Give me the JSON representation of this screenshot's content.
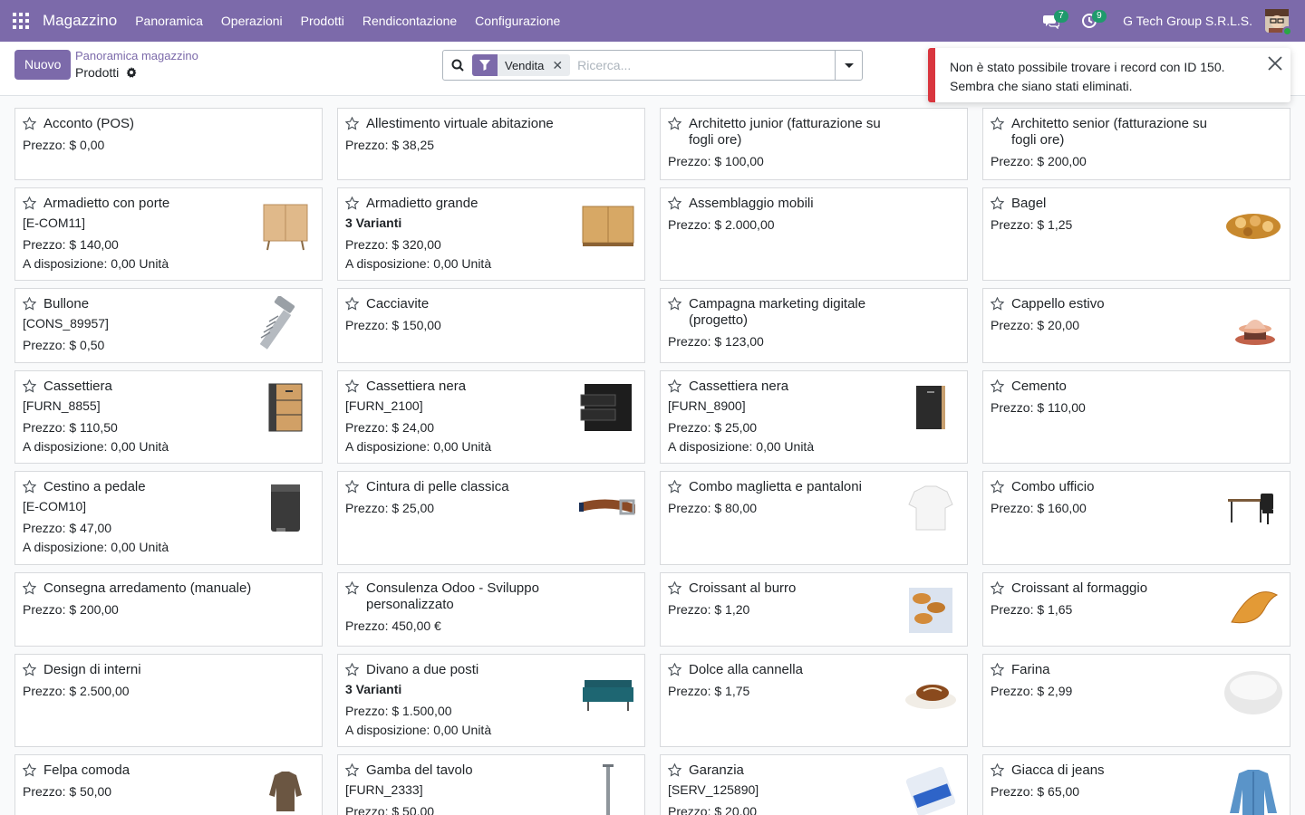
{
  "nav": {
    "app_name": "Magazzino",
    "menu": [
      "Panoramica",
      "Operazioni",
      "Prodotti",
      "Rendicontazione",
      "Configurazione"
    ],
    "messages_count": "7",
    "activities_count": "9",
    "company": "G Tech Group S.R.L.S."
  },
  "control": {
    "new_label": "Nuovo",
    "breadcrumb": "Panoramica magazzino",
    "title": "Prodotti",
    "facet_label": "Vendita",
    "search_placeholder": "Ricerca..."
  },
  "notification": {
    "text": "Non è stato possibile trovare i record con ID 150. Sembra che siano stati eliminati."
  },
  "products": [
    {
      "name": "Acconto (POS)",
      "sub": "",
      "price": "Prezzo: $ 0,00",
      "avail": "",
      "icon": "none"
    },
    {
      "name": "Allestimento virtuale abitazione",
      "sub": "",
      "price": "Prezzo: $ 38,25",
      "avail": "",
      "icon": "none"
    },
    {
      "name": "Architetto junior (fatturazione su fogli ore)",
      "sub": "",
      "price": "Prezzo: $ 100,00",
      "avail": "",
      "icon": "none"
    },
    {
      "name": "Architetto senior (fatturazione su fogli ore)",
      "sub": "",
      "price": "Prezzo: $ 200,00",
      "avail": "",
      "icon": "none"
    },
    {
      "name": "Armadietto con porte",
      "sub": "[E-COM11]",
      "price": "Prezzo: $ 140,00",
      "avail": "A disposizione: 0,00 Unità",
      "icon": "cabinet-doors"
    },
    {
      "name": "Armadietto grande",
      "sub": "3 Varianti",
      "subBold": true,
      "price": "Prezzo: $ 320,00",
      "avail": "A disposizione: 0,00 Unità",
      "icon": "cabinet-large"
    },
    {
      "name": "Assemblaggio mobili",
      "sub": "",
      "price": "Prezzo: $ 2.000,00",
      "avail": "",
      "icon": "none"
    },
    {
      "name": "Bagel",
      "sub": "",
      "price": "Prezzo: $ 1,25",
      "avail": "",
      "icon": "bagels"
    },
    {
      "name": "Bullone",
      "sub": "[CONS_89957]",
      "price": "Prezzo: $ 0,50",
      "avail": "",
      "icon": "bolt"
    },
    {
      "name": "Cacciavite",
      "sub": "",
      "price": "Prezzo: $ 150,00",
      "avail": "",
      "icon": "none"
    },
    {
      "name": "Campagna marketing digitale (progetto)",
      "sub": "",
      "price": "Prezzo: $ 123,00",
      "avail": "",
      "icon": "none"
    },
    {
      "name": "Cappello estivo",
      "sub": "",
      "price": "Prezzo: $ 20,00",
      "avail": "",
      "icon": "hats"
    },
    {
      "name": "Cassettiera",
      "sub": "[FURN_8855]",
      "price": "Prezzo: $ 110,50",
      "avail": "A disposizione: 0,00 Unità",
      "icon": "drawer-wood"
    },
    {
      "name": "Cassettiera nera",
      "sub": "[FURN_2100]",
      "price": "Prezzo: $ 24,00",
      "avail": "A disposizione: 0,00 Unità",
      "icon": "drawer-black-open"
    },
    {
      "name": "Cassettiera nera",
      "sub": "[FURN_8900]",
      "price": "Prezzo: $ 25,00",
      "avail": "A disposizione: 0,00 Unità",
      "icon": "drawer-black"
    },
    {
      "name": "Cemento",
      "sub": "",
      "price": "Prezzo: $ 110,00",
      "avail": "",
      "icon": "none"
    },
    {
      "name": "Cestino a pedale",
      "sub": "[E-COM10]",
      "price": "Prezzo: $ 47,00",
      "avail": "A disposizione: 0,00 Unità",
      "icon": "pedal-bin"
    },
    {
      "name": "Cintura di pelle classica",
      "sub": "",
      "price": "Prezzo: $ 25,00",
      "avail": "",
      "icon": "belt"
    },
    {
      "name": "Combo maglietta e pantaloni",
      "sub": "",
      "price": "Prezzo: $ 80,00",
      "avail": "",
      "icon": "shirt"
    },
    {
      "name": "Combo ufficio",
      "sub": "",
      "price": "Prezzo: $ 160,00",
      "avail": "",
      "icon": "office-desk"
    },
    {
      "name": "Consegna arredamento (manuale)",
      "sub": "",
      "price": "Prezzo: $ 200,00",
      "avail": "",
      "icon": "none"
    },
    {
      "name": "Consulenza Odoo - Sviluppo personalizzato",
      "sub": "",
      "price": "Prezzo: 450,00 €",
      "avail": "",
      "icon": "none"
    },
    {
      "name": "Croissant al burro",
      "sub": "",
      "price": "Prezzo: $ 1,20",
      "avail": "",
      "icon": "croissants"
    },
    {
      "name": "Croissant al formaggio",
      "sub": "",
      "price": "Prezzo: $ 1,65",
      "avail": "",
      "icon": "croissant"
    },
    {
      "name": "Design di interni",
      "sub": "",
      "price": "Prezzo: $ 2.500,00",
      "avail": "",
      "icon": "none"
    },
    {
      "name": "Divano a due posti",
      "sub": "3 Varianti",
      "subBold": true,
      "price": "Prezzo: $ 1.500,00",
      "avail": "A disposizione: 0,00 Unità",
      "icon": "sofa"
    },
    {
      "name": "Dolce alla cannella",
      "sub": "",
      "price": "Prezzo: $ 1,75",
      "avail": "",
      "icon": "cinnamon-roll"
    },
    {
      "name": "Farina",
      "sub": "",
      "price": "Prezzo: $ 2,99",
      "avail": "",
      "icon": "flour"
    },
    {
      "name": "Felpa comoda",
      "sub": "",
      "price": "Prezzo: $ 50,00",
      "avail": "",
      "icon": "sweater"
    },
    {
      "name": "Gamba del tavolo",
      "sub": "[FURN_2333]",
      "price": "Prezzo: $ 50,00",
      "avail": "",
      "icon": "table-leg"
    },
    {
      "name": "Garanzia",
      "sub": "[SERV_125890]",
      "price": "Prezzo: $ 20,00",
      "avail": "",
      "icon": "warranty-box"
    },
    {
      "name": "Giacca di jeans",
      "sub": "",
      "price": "Prezzo: $ 65,00",
      "avail": "",
      "icon": "jeans-jacket"
    }
  ],
  "colors": {
    "brand": "#7c6aaa",
    "danger": "#d9363e",
    "badge": "#1f9a6c"
  }
}
